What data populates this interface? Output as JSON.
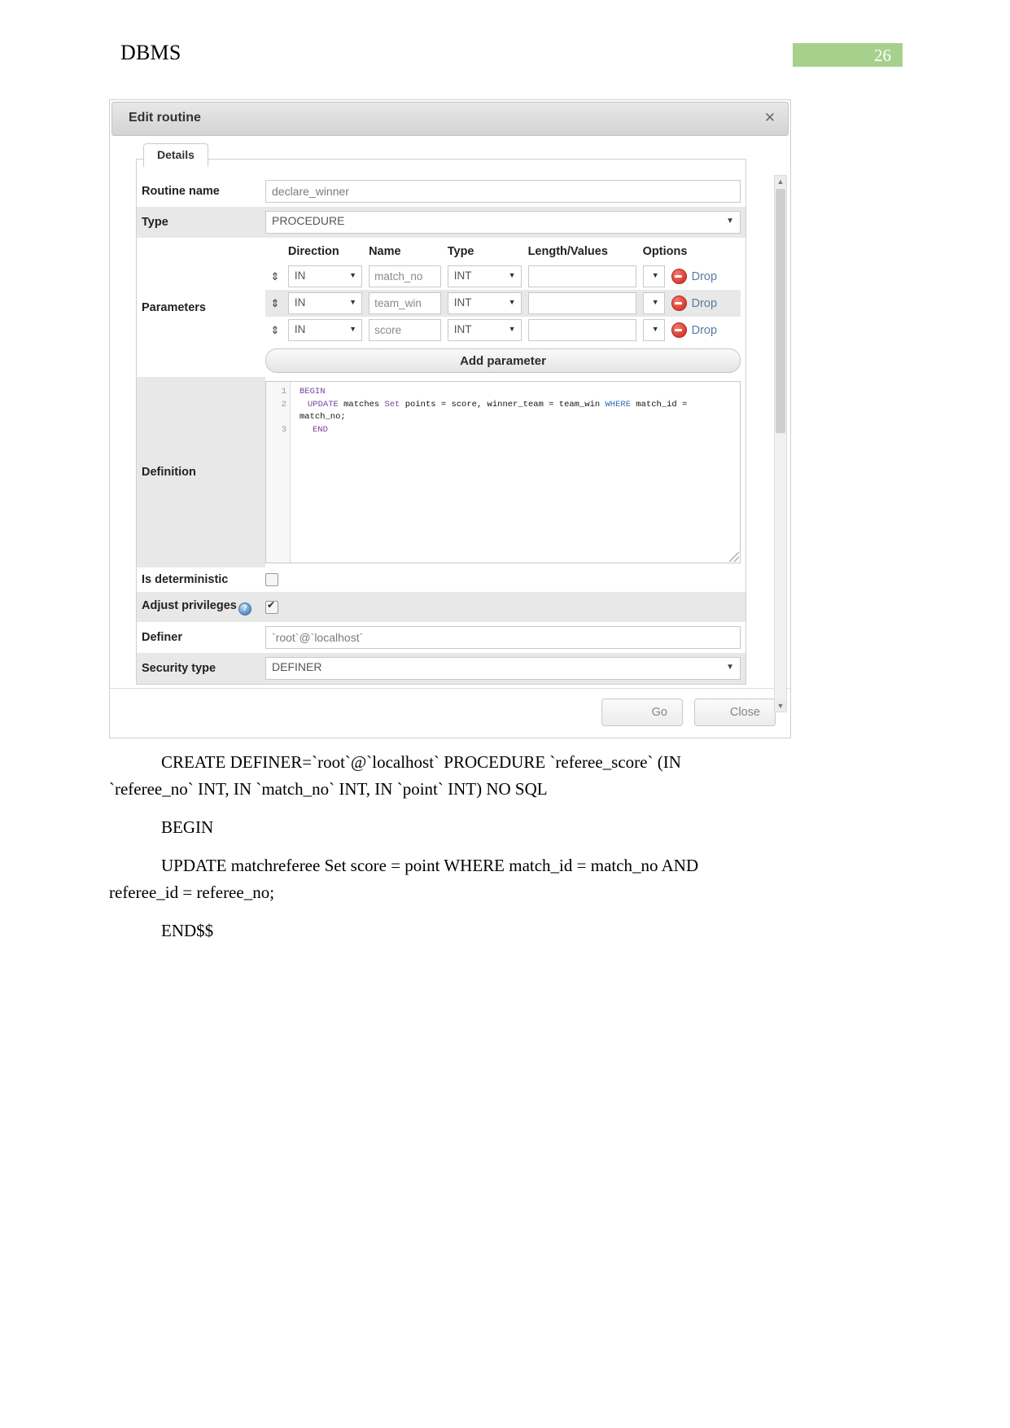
{
  "document": {
    "header_title": "DBMS",
    "page_number": "26"
  },
  "dialog": {
    "title": "Edit routine",
    "close_icon": "✕",
    "tab": "Details",
    "fields": {
      "routine_name_label": "Routine name",
      "routine_name_value": "declare_winner",
      "type_label": "Type",
      "type_value": "PROCEDURE",
      "parameters_label": "Parameters",
      "definition_label": "Definition",
      "is_deterministic_label": "Is deterministic",
      "adjust_privileges_label": "Adjust privileges",
      "definer_label": "Definer",
      "definer_value": "`root`@`localhost`",
      "security_type_label": "Security type",
      "security_type_value": "DEFINER"
    },
    "parameters": {
      "headers": [
        "Direction",
        "Name",
        "Type",
        "Length/Values",
        "Options"
      ],
      "rows": [
        {
          "direction": "IN",
          "name": "match_no",
          "type": "INT",
          "length": "",
          "options": "",
          "drop_label": "Drop"
        },
        {
          "direction": "IN",
          "name": "team_win",
          "type": "INT",
          "length": "",
          "options": "",
          "drop_label": "Drop"
        },
        {
          "direction": "IN",
          "name": "score",
          "type": "INT",
          "length": "",
          "options": "",
          "drop_label": "Drop"
        }
      ],
      "add_button": "Add parameter"
    },
    "definition_code": {
      "line_numbers": [
        "1",
        "2",
        "3"
      ],
      "line1_kw": "BEGIN",
      "line2_kw1": "UPDATE",
      "line2_t1": " matches ",
      "line2_kw2": "Set",
      "line2_t2": " points = score, winner_team = team_win ",
      "line2_kw3": "WHERE",
      "line2_t3": " match_id = match_no;",
      "line3_kw": "END"
    },
    "checkbox_states": {
      "is_deterministic": "unchecked",
      "adjust_privileges": "checked"
    },
    "footer": {
      "go_label": "Go",
      "close_label": "Close"
    },
    "colors": {
      "titlebar_top": "#e8e8e8",
      "titlebar_bottom": "#d3d3d3",
      "alt_row": "#e8e8e8",
      "drop_link": "#5a7ba0",
      "drop_icon": "#d9372a",
      "keyword_purple": "#7a3fa0",
      "keyword_blue": "#2f6fb5",
      "page_badge": "#a8d08d"
    }
  },
  "body_text": {
    "p1_indent": "",
    "p1_line1": "CREATE    DEFINER=`root`@`localhost`    PROCEDURE    `referee_score`    (IN",
    "p1_line2": "`referee_no` INT, IN `match_no` INT, IN `point` INT)  NO SQL",
    "p2": "BEGIN",
    "p3_line1": "UPDATE  matchreferee  Set  score  =  point  WHERE  match_id  =  match_no  AND",
    "p3_line2": "referee_id = referee_no;",
    "p4": "END$$"
  }
}
